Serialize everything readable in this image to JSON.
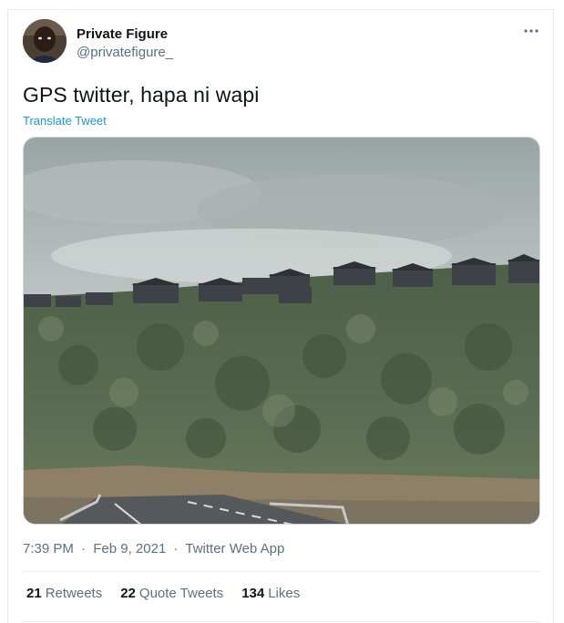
{
  "author": {
    "name": "Private Figure",
    "handle": "@privatefigure_"
  },
  "tweet": {
    "text": "GPS twitter, hapa ni wapi",
    "translate_label": "Translate Tweet",
    "time": "7:39 PM",
    "date": "Feb 9, 2021",
    "separator": "·",
    "source": "Twitter Web App"
  },
  "stats": {
    "retweets_count": "21",
    "retweets_label": "Retweets",
    "quotes_count": "22",
    "quotes_label": "Quote Tweets",
    "likes_count": "134",
    "likes_label": "Likes"
  },
  "icons": {
    "more": "more-horizontal-icon"
  },
  "colors": {
    "link": "#1b95e0",
    "secondary_text": "#5b7083",
    "primary_text": "#0f1419",
    "border": "#e6ecf0"
  }
}
